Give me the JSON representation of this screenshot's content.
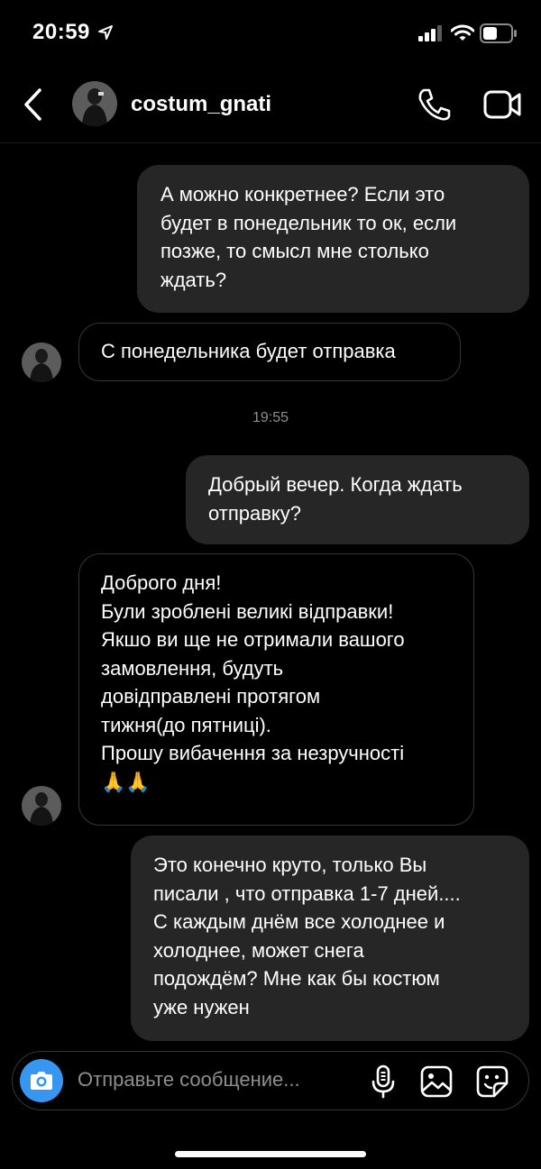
{
  "status_bar": {
    "time": "20:59"
  },
  "header": {
    "username": "costum_gnati"
  },
  "messages": [
    {
      "direction": "sent",
      "lines": [
        "А можно конкретнее? Если это",
        "будет в понедельник то ок, если",
        "позже, то смысл мне столько",
        "ждать?"
      ]
    },
    {
      "direction": "received",
      "lines": [
        "С понедельника будет отправка"
      ]
    },
    {
      "direction": "sent",
      "lines": [
        "Добрый вечер. Когда ждать",
        "отправку?"
      ]
    },
    {
      "direction": "received",
      "lines": [
        "Доброго дня!",
        "Були зроблені великі відправки!",
        "Якшо ви ще не отримали вашого",
        "замовлення, будуть",
        "довідправлені протягом",
        "тижня(до пятниці).",
        "Прошу вибачення за незручності",
        "🙏🙏"
      ]
    },
    {
      "direction": "sent",
      "lines": [
        "Это конечно круто, только Вы",
        "писали , что отправка 1-7 дней....",
        "С каждым днём все холоднее и",
        "холоднее, может снега",
        "подождём? Мне как бы костюм",
        "уже нужен"
      ]
    }
  ],
  "timestamp": "19:55",
  "composer": {
    "placeholder": "Отправьте сообщение..."
  },
  "colors": {
    "background": "#000000",
    "sent_bubble": "#262626",
    "received_border": "#363636",
    "accent": "#3797f0",
    "muted_text": "#8e8e8e"
  },
  "icons": [
    "location-arrow-icon",
    "signal-icon",
    "wifi-icon",
    "battery-icon",
    "back-icon",
    "phone-icon",
    "video-icon",
    "camera-icon",
    "microphone-icon",
    "gallery-icon",
    "sticker-icon"
  ]
}
